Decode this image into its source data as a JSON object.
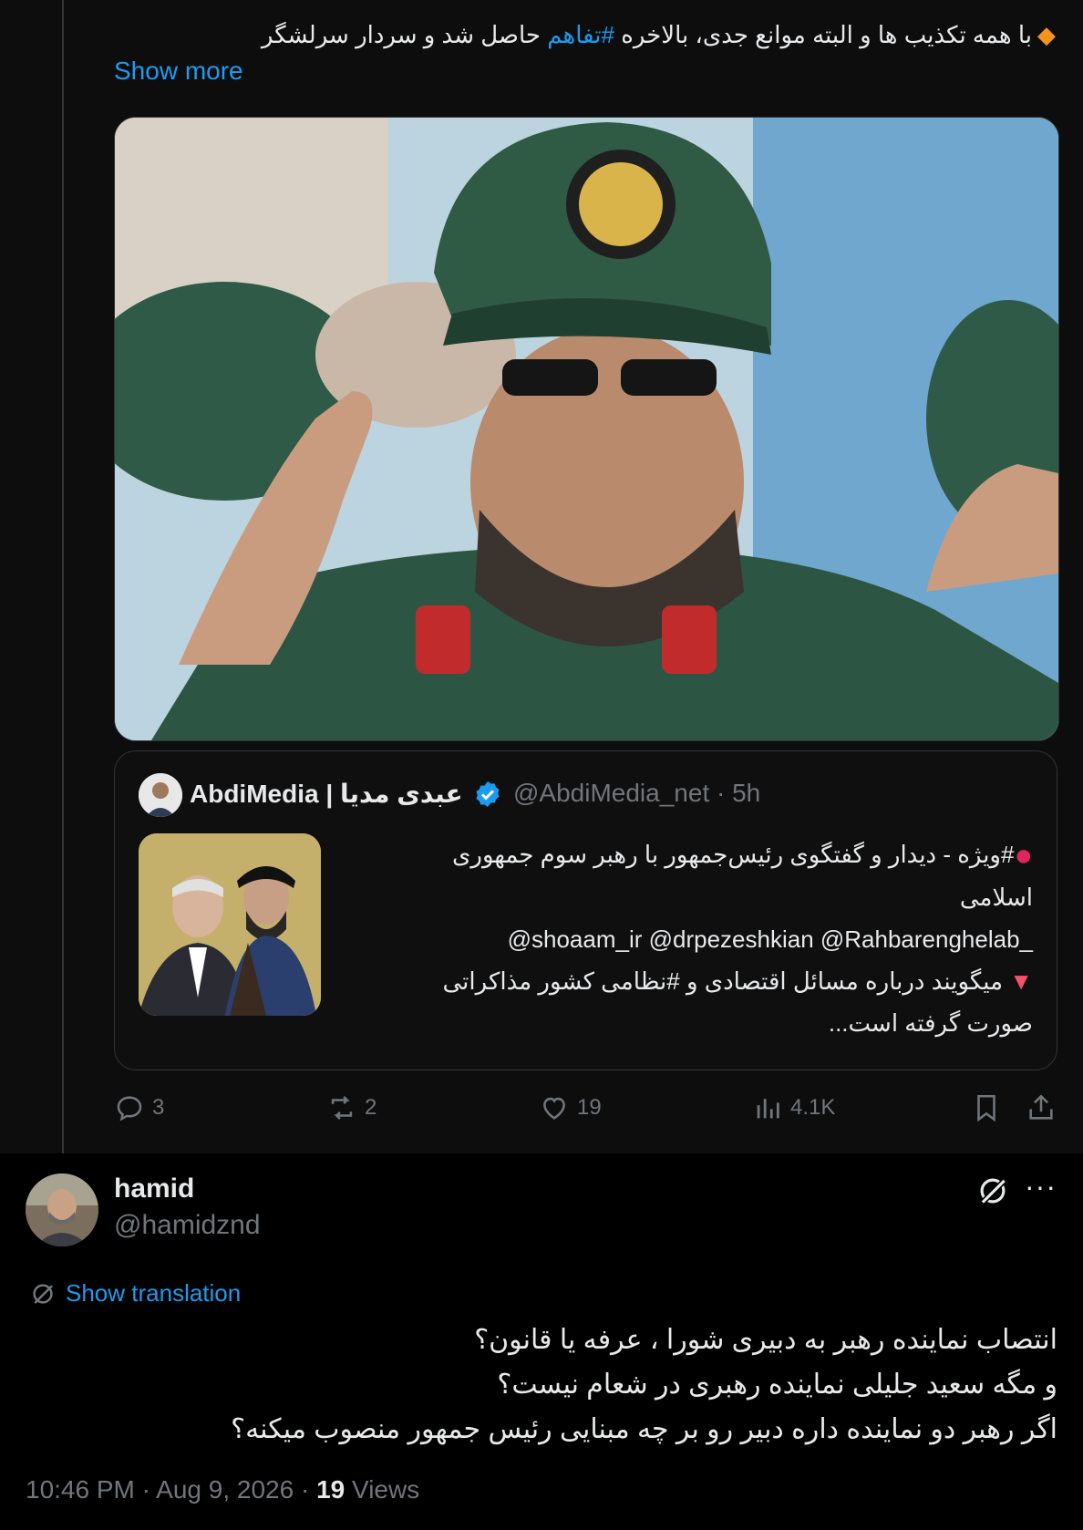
{
  "quoted_tweet": {
    "text_line": "حاصل شد و سردار سرلشگر",
    "text_prefix": "با همه تکذیب ها و البته موانع جدی، بالاخره",
    "diamond_icon": "orange-diamond-icon",
    "hashtag": "#تفاهم",
    "show_more": "Show more",
    "embedded_quote": {
      "name": "AbdiMedia | عبدی مدیا",
      "handle_time": "@AbdiMedia_net · 5h",
      "lines": [
        "#ویژه - دیدار و گفتگوی رئیس‌جمهور با رهبر سوم جمهوری",
        "اسلامی",
        "@shoaam_ir @drpezeshkian @Rahbarenghelab_",
        "میگویند درباره مسائل اقتصادی و #نظامی کشور مذاکراتی",
        "صورت گرفته است..."
      ]
    },
    "actions": {
      "replies": "3",
      "reposts": "2",
      "likes": "19",
      "views": "4.1K"
    }
  },
  "main_tweet": {
    "name": "hamid",
    "handle": "@hamidznd",
    "show_translation": "Show translation",
    "lines": [
      "انتصاب نماینده رهبر به دبیری شورا ، عرفه یا قانون؟",
      "و مگه سعید جلیلی نماینده رهبری در شعام نیست؟",
      "اگر رهبر دو نماینده داره دبیر رو بر چه مبنایی رئیس جمهور منصوب میکنه؟"
    ],
    "timestamp": "10:46 PM · Aug 9, 2026 · ",
    "views_count": "19",
    "views_label": " Views"
  },
  "colors": {
    "accent": "#1d9bf0",
    "muted": "#71767b",
    "background": "#000000"
  }
}
